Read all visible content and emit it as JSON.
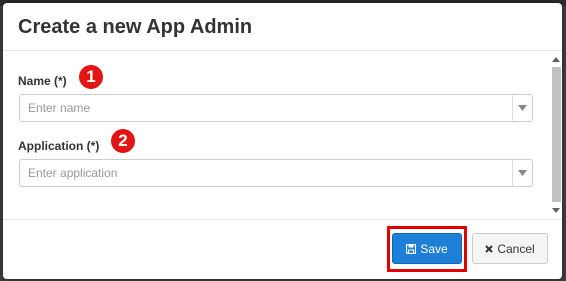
{
  "dialog": {
    "title": "Create a new App Admin"
  },
  "form": {
    "name": {
      "label": "Name (*)",
      "placeholder": "Enter name",
      "badge": "1"
    },
    "application": {
      "label": "Application (*)",
      "placeholder": "Enter application",
      "badge": "2"
    }
  },
  "footer": {
    "save_label": "Save",
    "cancel_label": "Cancel",
    "save_icon": "floppy-disk-icon",
    "cancel_icon": "close-icon"
  },
  "colors": {
    "primary": "#1e7fd6",
    "highlight": "#e60000",
    "badge": "#e21414"
  }
}
